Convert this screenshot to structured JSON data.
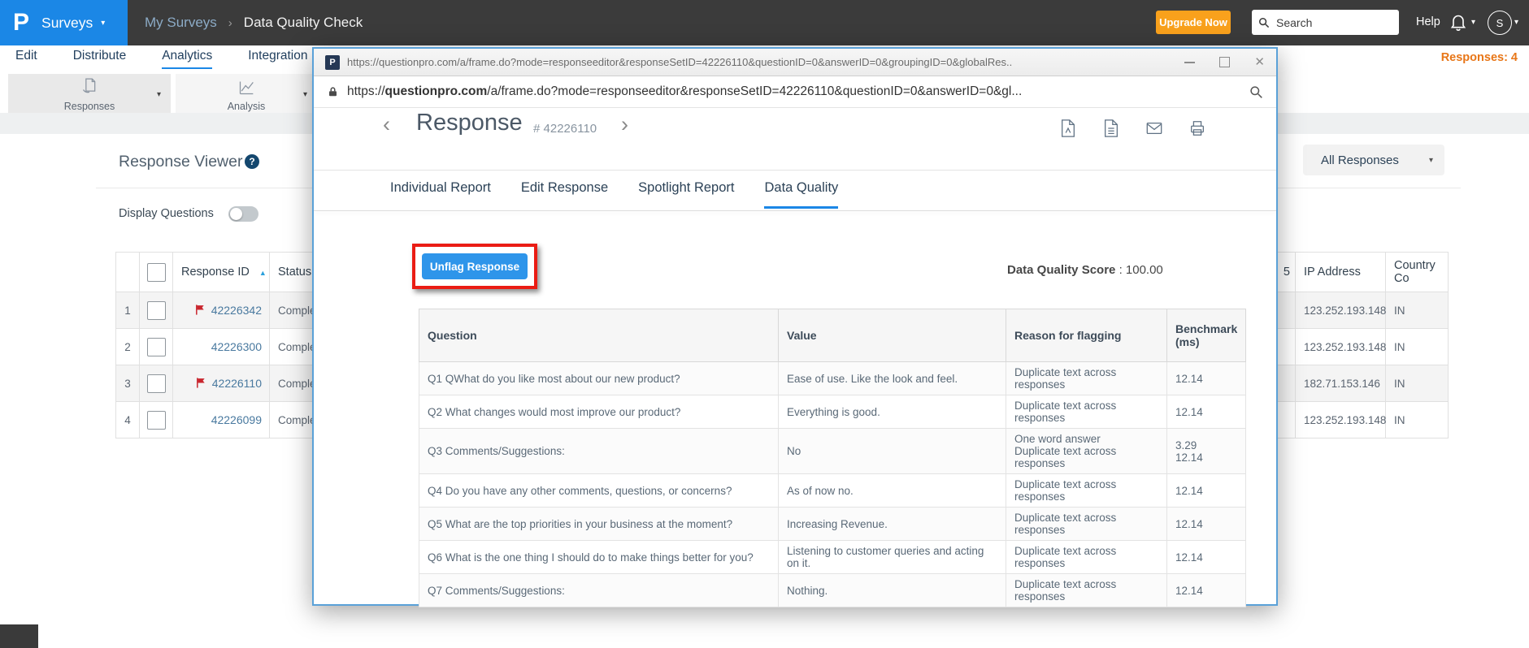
{
  "topbar": {
    "logo_letter": "P",
    "product_label": "Surveys",
    "breadcrumb": {
      "parent": "My Surveys",
      "separator": "›",
      "current": "Data Quality Check"
    },
    "upgrade_label": "Upgrade Now",
    "search_placeholder": "Search",
    "help_label": "Help",
    "avatar_initial": "S"
  },
  "nav": {
    "items": [
      {
        "label": "Edit",
        "active": false
      },
      {
        "label": "Distribute",
        "active": false
      },
      {
        "label": "Analytics",
        "active": true
      },
      {
        "label": "Integration",
        "active": false
      }
    ],
    "responses_count": "Responses: 4"
  },
  "toolbar": {
    "groups": [
      {
        "label": "Responses",
        "icon": "document-hand-icon"
      },
      {
        "label": "Analysis",
        "icon": "line-chart-icon"
      }
    ]
  },
  "viewer": {
    "title": "Response Viewer",
    "help_glyph": "?",
    "display_questions_label": "Display Questions",
    "toggle_on": false,
    "filter_value": "All Responses",
    "left_table": {
      "headers": {
        "response_id": "Response ID",
        "status": "Status"
      },
      "rows": [
        {
          "num": "1",
          "id": "42226342",
          "flagged": true,
          "status": "Comple"
        },
        {
          "num": "2",
          "id": "42226300",
          "flagged": false,
          "status": "Comple"
        },
        {
          "num": "3",
          "id": "42226110",
          "flagged": true,
          "status": "Comple"
        },
        {
          "num": "4",
          "id": "42226099",
          "flagged": false,
          "status": "Comple"
        }
      ]
    },
    "right_table": {
      "headers": {
        "col5": "5",
        "ip": "IP Address",
        "country": "Country Co"
      },
      "rows": [
        {
          "ip": "123.252.193.148",
          "country": "IN"
        },
        {
          "ip": "123.252.193.148",
          "country": "IN"
        },
        {
          "ip": "182.71.153.146",
          "country": "IN"
        },
        {
          "ip": "123.252.193.148",
          "country": "IN"
        }
      ]
    }
  },
  "modal": {
    "titlebar": {
      "logo_letter": "P",
      "url": "https://questionpro.com/a/frame.do?mode=responseeditor&responseSetID=42226110&questionID=0&answerID=0&groupingID=0&globalRes..",
      "close_glyph": "✕"
    },
    "addressbar": {
      "url_prefix": "https://",
      "url_domain": "questionpro.com",
      "url_path": "/a/frame.do?mode=responseeditor&responseSetID=42226110&questionID=0&answerID=0&gl..."
    },
    "header": {
      "prev_glyph": "‹",
      "title": "Response",
      "id_label": "# 42226110",
      "next_glyph": "›"
    },
    "tabs": [
      {
        "label": "Individual Report",
        "active": false
      },
      {
        "label": "Edit Response",
        "active": false
      },
      {
        "label": "Spotlight Report",
        "active": false
      },
      {
        "label": "Data Quality",
        "active": true
      }
    ],
    "unflag_label": "Unflag Response",
    "score": {
      "label": "Data Quality Score",
      "value": ": 100.00"
    },
    "table": {
      "headers": [
        "Question",
        "Value",
        "Reason for flagging",
        "Benchmark (ms)"
      ],
      "rows": [
        {
          "question": "Q1  QWhat do you like most about our new product?",
          "value": "Ease of use. Like the look and feel.",
          "reasons": [
            "Duplicate text across responses"
          ],
          "benchmarks": [
            "12.14"
          ]
        },
        {
          "question": "Q2 What changes would most improve our product?",
          "value": "Everything is good.",
          "reasons": [
            "Duplicate text across responses"
          ],
          "benchmarks": [
            "12.14"
          ]
        },
        {
          "question": "Q3 Comments/Suggestions:",
          "value": "No",
          "reasons": [
            "One word answer",
            "Duplicate text across responses"
          ],
          "benchmarks": [
            "3.29",
            "12.14"
          ]
        },
        {
          "question": "Q4 Do you have any other comments, questions, or concerns?",
          "value": "As of now no.",
          "reasons": [
            "Duplicate text across responses"
          ],
          "benchmarks": [
            "12.14"
          ]
        },
        {
          "question": "Q5 What are the top priorities in your business at the moment?",
          "value": "Increasing Revenue.",
          "reasons": [
            "Duplicate text across responses"
          ],
          "benchmarks": [
            "12.14"
          ]
        },
        {
          "question": "Q6 What is the one thing I should do to make things better for you?",
          "value": "Listening to customer queries and acting on it.",
          "reasons": [
            "Duplicate text across responses"
          ],
          "benchmarks": [
            "12.14"
          ]
        },
        {
          "question": "Q7 Comments/Suggestions:",
          "value": "Nothing.",
          "reasons": [
            "Duplicate text across responses"
          ],
          "benchmarks": [
            "12.14"
          ]
        }
      ]
    }
  },
  "colors": {
    "accent_blue": "#1b87e6",
    "topbar_bg": "#3b3b3b",
    "upgrade_orange": "#f9a11c",
    "responses_count_orange": "#e87617",
    "flag_red": "#c9252d",
    "annotation_red": "#ea1c14",
    "unflag_button_blue": "#2e95ea",
    "link_blue": "#49799f"
  },
  "icons": {
    "search": "magnifier",
    "bell": "notifications",
    "lock": "secure-connection",
    "pdf": "export-pdf",
    "xls": "export-excel",
    "email": "send-email",
    "print": "print"
  }
}
